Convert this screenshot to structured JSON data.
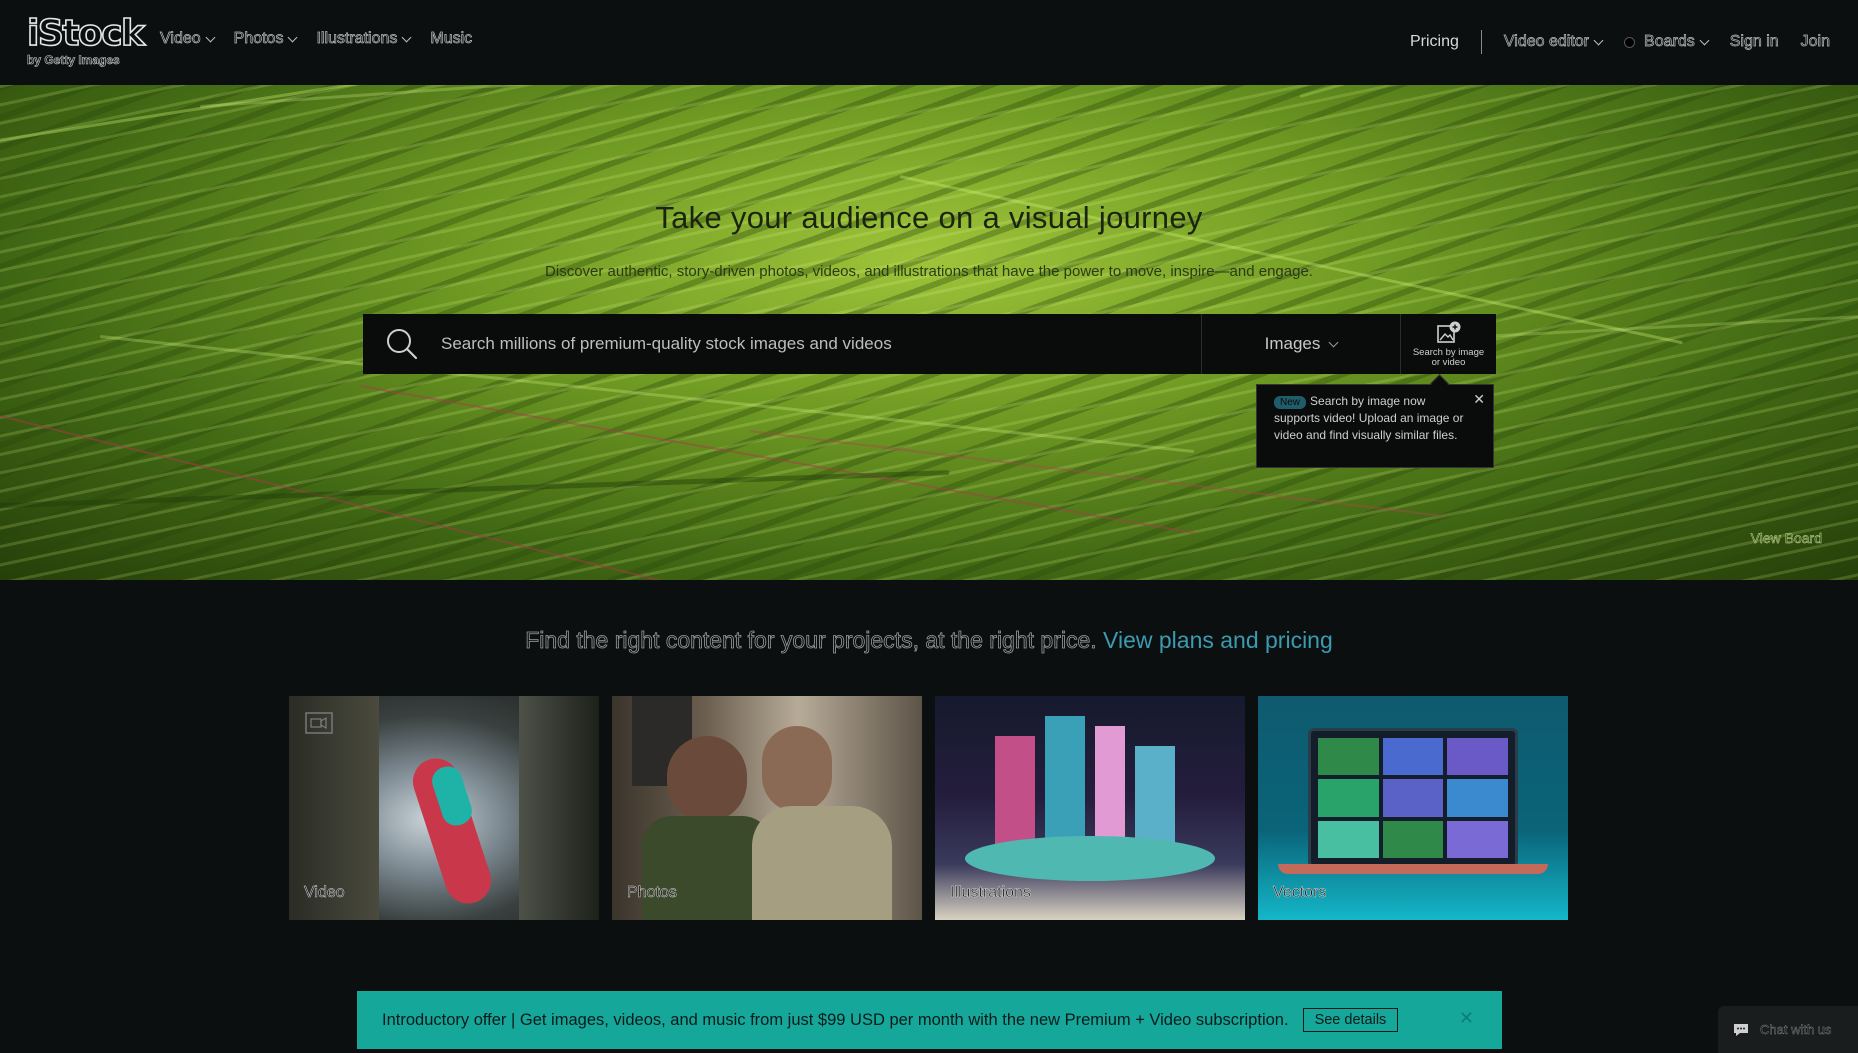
{
  "header": {
    "logo": "iStock",
    "logo_sub": "by Getty Images",
    "nav_left": [
      {
        "label": "Video",
        "has_dropdown": true
      },
      {
        "label": "Photos",
        "has_dropdown": true
      },
      {
        "label": "Illustrations",
        "has_dropdown": true
      },
      {
        "label": "Music",
        "has_dropdown": false
      }
    ],
    "pricing": "Pricing",
    "video_editor": "Video editor",
    "boards": "Boards",
    "sign_in": "Sign in",
    "join": "Join"
  },
  "hero": {
    "title": "Take your audience on a visual journey",
    "subtitle": "Discover authentic, story-driven photos, videos, and illustrations that have the power to move, inspire—and engage.",
    "view_board": "View Board"
  },
  "search": {
    "placeholder": "Search millions of premium-quality stock images and videos",
    "type_value": "Images",
    "search_by_image_label_1": "Search by image",
    "search_by_image_label_2": "or video"
  },
  "tooltip": {
    "badge": "New",
    "text": "Search by image now supports video! Upload an image or video and find visually similar files."
  },
  "pricing_line": {
    "text": "Find the right content for your projects, at the right price.",
    "link": "View plans and pricing"
  },
  "cards": [
    {
      "label": "Video"
    },
    {
      "label": "Photos"
    },
    {
      "label": "Illustrations"
    },
    {
      "label": "Vectors"
    }
  ],
  "banner": {
    "text": "Introductory offer | Get images, videos, and music from just $99 USD per month with the new Premium + Video subscription.",
    "button": "See details"
  },
  "chat": {
    "label": "Chat with us"
  },
  "colors": {
    "accent_link": "#3a9bb1",
    "banner_bg": "#14a79a",
    "page_bg": "#0c0f10"
  }
}
